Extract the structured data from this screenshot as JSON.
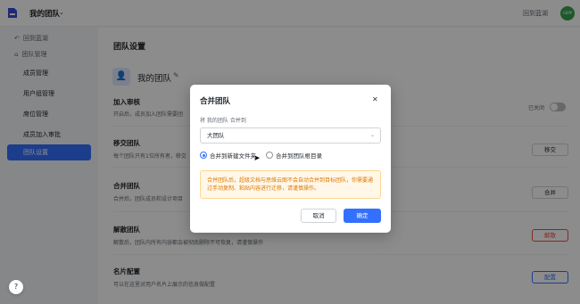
{
  "header": {
    "team_name": "我的团队",
    "back_link": "回到蓝湖",
    "avatar_text": "GBPP"
  },
  "sidebar": {
    "back": "回到蓝湖",
    "team_manage": "团队管理",
    "items": [
      "成员管理",
      "用户组管理",
      "席位管理",
      "成员加入审批",
      "团队设置"
    ]
  },
  "main": {
    "page_title": "团队设置",
    "team_name": "我的团队",
    "sections": [
      {
        "title": "加入审核",
        "desc": "开启后，成员加入团队需要团",
        "toggle_label": "已关闭"
      },
      {
        "title": "移交团队",
        "desc": "每个团队只有1位所有者，移交",
        "button": "移交"
      },
      {
        "title": "合并团队",
        "desc": "合并后，团队成员和设计项目",
        "button": "合并"
      },
      {
        "title": "解散团队",
        "desc": "解散后，团队内所有内容都会被彻底删除不可恢复，请谨慎操作",
        "button": "解散"
      },
      {
        "title": "名片配置",
        "desc": "可以在这里对用户名片上展示的信息做配置",
        "button": "配置"
      }
    ]
  },
  "modal": {
    "title": "合并团队",
    "merge_label": "将 我的团队 合并到",
    "select_value": "大团队",
    "radio_new_folder": "合并到新建文件夹",
    "radio_root": "合并到团队根目录",
    "warning": "合并团队后，超级文档与思维云图不会自动合并到目标团队，你需要通过手动复制、粘贴内容进行迁移，请谨慎操作。",
    "cancel": "取消",
    "confirm": "确定"
  },
  "help": "?"
}
